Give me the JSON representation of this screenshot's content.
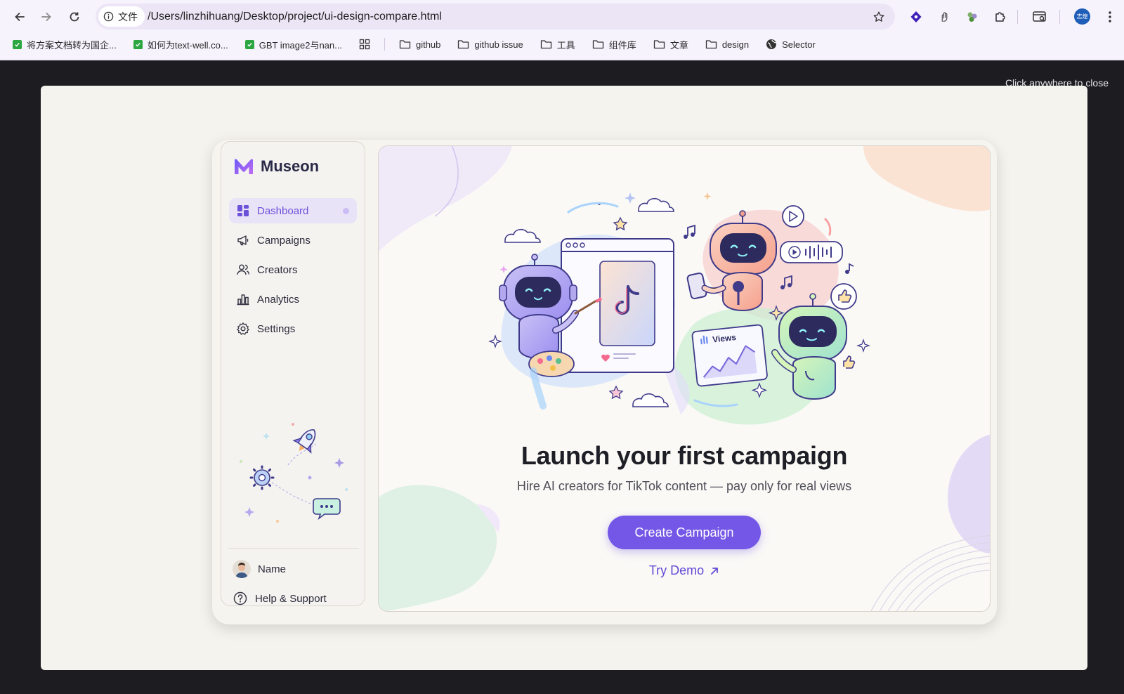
{
  "browser": {
    "site_chip": "文件",
    "url": "/Users/linzhihuang/Desktop/project/ui-design-compare.html",
    "profile_initials": "志煌",
    "bookmarks": [
      {
        "label": "将方案文档转为国企...",
        "icon": "check-icon"
      },
      {
        "label": "如何为text-well.co...",
        "icon": "check-icon"
      },
      {
        "label": "GBT image2与nan...",
        "icon": "check-icon"
      }
    ],
    "folders": [
      "github",
      "github issue",
      "工具",
      "组件库",
      "文章",
      "design"
    ],
    "selector_label": "Selector"
  },
  "overlay": {
    "close_hint": "Click anywhere to close"
  },
  "app": {
    "brand": "Museon",
    "nav": [
      {
        "label": "Dashboard",
        "icon": "dashboard-icon",
        "active": true
      },
      {
        "label": "Campaigns",
        "icon": "megaphone-icon"
      },
      {
        "label": "Creators",
        "icon": "users-icon"
      },
      {
        "label": "Analytics",
        "icon": "bar-chart-icon"
      },
      {
        "label": "Settings",
        "icon": "gear-icon"
      }
    ],
    "user_name": "Name",
    "help_label": "Help & Support"
  },
  "main": {
    "illustration_views_label": "Views",
    "headline": "Launch your first campaign",
    "subline": "Hire AI creators for TikTok content — pay only for real views",
    "cta_label": "Create Campaign",
    "demo_label": "Try Demo"
  },
  "colors": {
    "accent": "#7457e6",
    "active_bg": "#e9e3f8",
    "modal_bg": "#f5f3ed",
    "backdrop": "#1c1c21"
  }
}
